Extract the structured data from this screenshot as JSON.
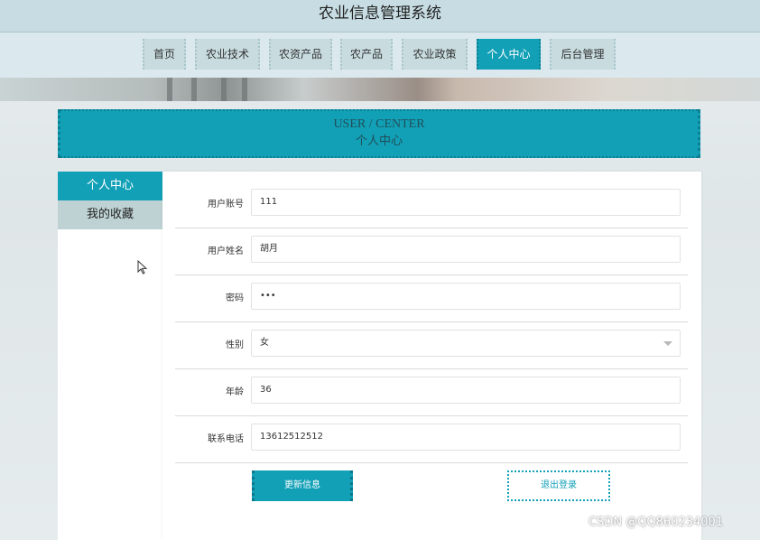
{
  "site": {
    "title": "农业信息管理系统"
  },
  "nav": {
    "items": [
      {
        "label": "首页"
      },
      {
        "label": "农业技术"
      },
      {
        "label": "农资产品"
      },
      {
        "label": "农产品"
      },
      {
        "label": "农业政策"
      },
      {
        "label": "个人中心",
        "active": true
      },
      {
        "label": "后台管理"
      }
    ]
  },
  "header": {
    "en": "USER / CENTER",
    "cn": "个人中心"
  },
  "sidebar": {
    "items": [
      {
        "label": "个人中心",
        "active": true
      },
      {
        "label": "我的收藏"
      }
    ]
  },
  "form": {
    "account": {
      "label": "用户账号",
      "value": "111"
    },
    "name": {
      "label": "用户姓名",
      "value": "胡月"
    },
    "password": {
      "label": "密码",
      "value": "•••"
    },
    "gender": {
      "label": "性别",
      "value": "女"
    },
    "age": {
      "label": "年龄",
      "value": "36"
    },
    "phone": {
      "label": "联系电话",
      "value": "13612512512"
    }
  },
  "actions": {
    "update_label": "更新信息",
    "logout_label": "退出登录"
  },
  "watermark": "CSDN @QQ860234001",
  "colors": {
    "accent": "#12a0b7",
    "topbar": "#c7dde3",
    "navbar": "#dbe9ef",
    "nav_item": "#c8dce0",
    "sidebar_item": "#bed2d4"
  }
}
